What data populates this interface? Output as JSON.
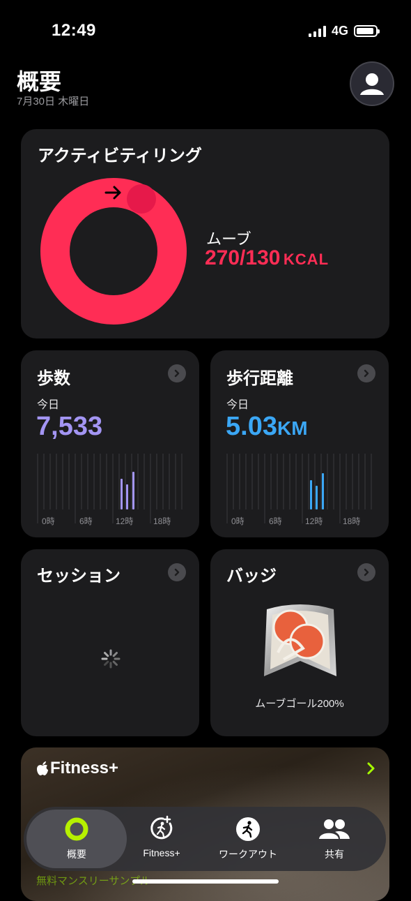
{
  "status": {
    "time": "12:49",
    "network": "4G"
  },
  "header": {
    "title": "概要",
    "date": "7月30日 木曜日"
  },
  "activity": {
    "title": "アクティビティリング",
    "move_label": "ムーブ",
    "move_value": "270/130",
    "move_unit": "KCAL",
    "move_percent": 207,
    "ring_color": "#ff2d55"
  },
  "steps": {
    "title": "歩数",
    "today_label": "今日",
    "value": "7,533",
    "color": "#a395f3",
    "axis": [
      "0時",
      "6時",
      "12時",
      "18時"
    ]
  },
  "distance": {
    "title": "歩行距離",
    "today_label": "今日",
    "value": "5.03",
    "unit": "KM",
    "color": "#3ba7f5",
    "axis": [
      "0時",
      "6時",
      "12時",
      "18時"
    ]
  },
  "sessions": {
    "title": "セッション"
  },
  "badges": {
    "title": "バッジ",
    "badge_label": "ムーブゴール200%"
  },
  "fitness_plus": {
    "title": "Fitness+",
    "subtitle": "無料マンスリーサンプル"
  },
  "tabs": [
    {
      "label": "概要",
      "icon": "rings-icon",
      "active": true
    },
    {
      "label": "Fitness+",
      "icon": "fitness-plus-icon",
      "active": false
    },
    {
      "label": "ワークアウト",
      "icon": "workout-runner-icon",
      "active": false
    },
    {
      "label": "共有",
      "icon": "sharing-people-icon",
      "active": false
    }
  ]
}
